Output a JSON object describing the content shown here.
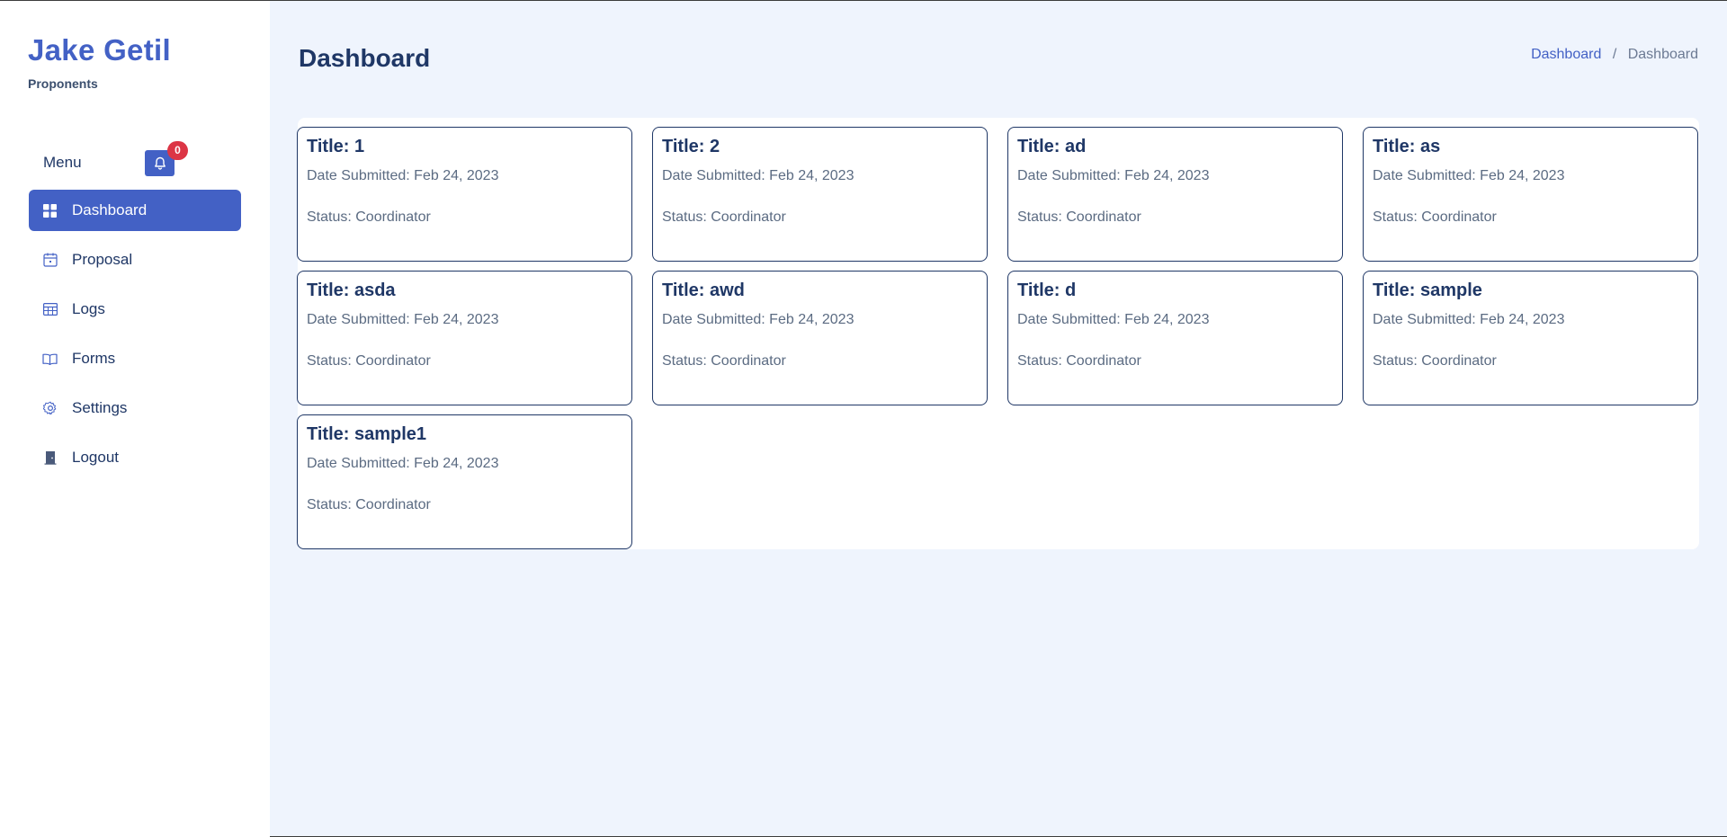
{
  "sidebar": {
    "brand": {
      "name": "Jake Getil",
      "role": "Proponents"
    },
    "menu_label": "Menu",
    "notification_count": "0",
    "items": [
      {
        "label": "Dashboard",
        "icon": "grid-icon",
        "active": true
      },
      {
        "label": "Proposal",
        "icon": "calendar-icon"
      },
      {
        "label": "Logs",
        "icon": "table-icon"
      },
      {
        "label": "Forms",
        "icon": "book-icon"
      },
      {
        "label": "Settings",
        "icon": "gear-icon"
      },
      {
        "label": "Logout",
        "icon": "door-icon"
      }
    ]
  },
  "header": {
    "title": "Dashboard",
    "breadcrumb": {
      "link": "Dashboard",
      "separator": "/",
      "current": "Dashboard"
    }
  },
  "cards": [
    {
      "title": "Title: 1",
      "date": "Date Submitted: Feb 24, 2023",
      "status": "Status: Coordinator"
    },
    {
      "title": "Title: 2",
      "date": "Date Submitted: Feb 24, 2023",
      "status": "Status: Coordinator"
    },
    {
      "title": "Title: ad",
      "date": "Date Submitted: Feb 24, 2023",
      "status": "Status: Coordinator"
    },
    {
      "title": "Title: as",
      "date": "Date Submitted: Feb 24, 2023",
      "status": "Status: Coordinator"
    },
    {
      "title": "Title: asda",
      "date": "Date Submitted: Feb 24, 2023",
      "status": "Status: Coordinator"
    },
    {
      "title": "Title: awd",
      "date": "Date Submitted: Feb 24, 2023",
      "status": "Status: Coordinator"
    },
    {
      "title": "Title: d",
      "date": "Date Submitted: Feb 24, 2023",
      "status": "Status: Coordinator"
    },
    {
      "title": "Title: sample",
      "date": "Date Submitted: Feb 24, 2023",
      "status": "Status: Coordinator"
    },
    {
      "title": "Title: sample1",
      "date": "Date Submitted: Feb 24, 2023",
      "status": "Status: Coordinator"
    }
  ],
  "colors": {
    "accent": "#4361c5",
    "text": "#1f3766",
    "badge": "#dc3545",
    "background": "#eff4fd"
  }
}
